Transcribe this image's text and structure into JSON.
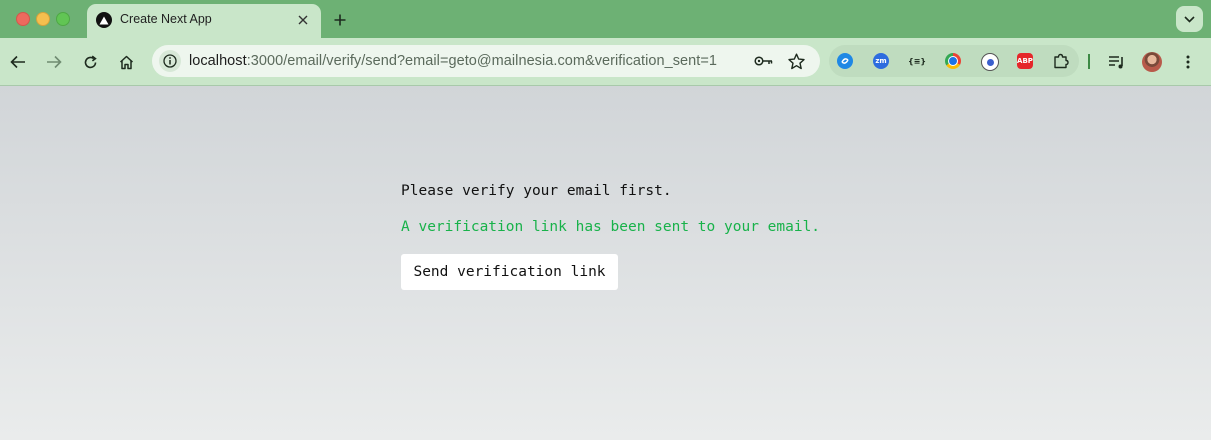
{
  "colors": {
    "tab_strip": "#6db174",
    "toolbar": "#c9e6c9",
    "success_text": "#18b24a"
  },
  "tab": {
    "title": "Create Next App",
    "favicon": "nextjs-triangle-icon"
  },
  "address_bar": {
    "host": "localhost",
    "path": ":3000/email/verify/send?email=geto@mailnesia.com&verification_sent=1"
  },
  "extensions": [
    "sync-icon",
    "zoom-icon",
    "json-viewer-icon",
    "color-picker-icon",
    "extension-icon",
    "adblock-plus-icon",
    "puzzle-icon"
  ],
  "extension_labels": {
    "zoom": "zm",
    "json": "{≡}",
    "abp": "ABP"
  },
  "page": {
    "prompt": "Please verify your email first.",
    "status": "A verification link has been sent to your email.",
    "button_label": "Send verification link"
  }
}
